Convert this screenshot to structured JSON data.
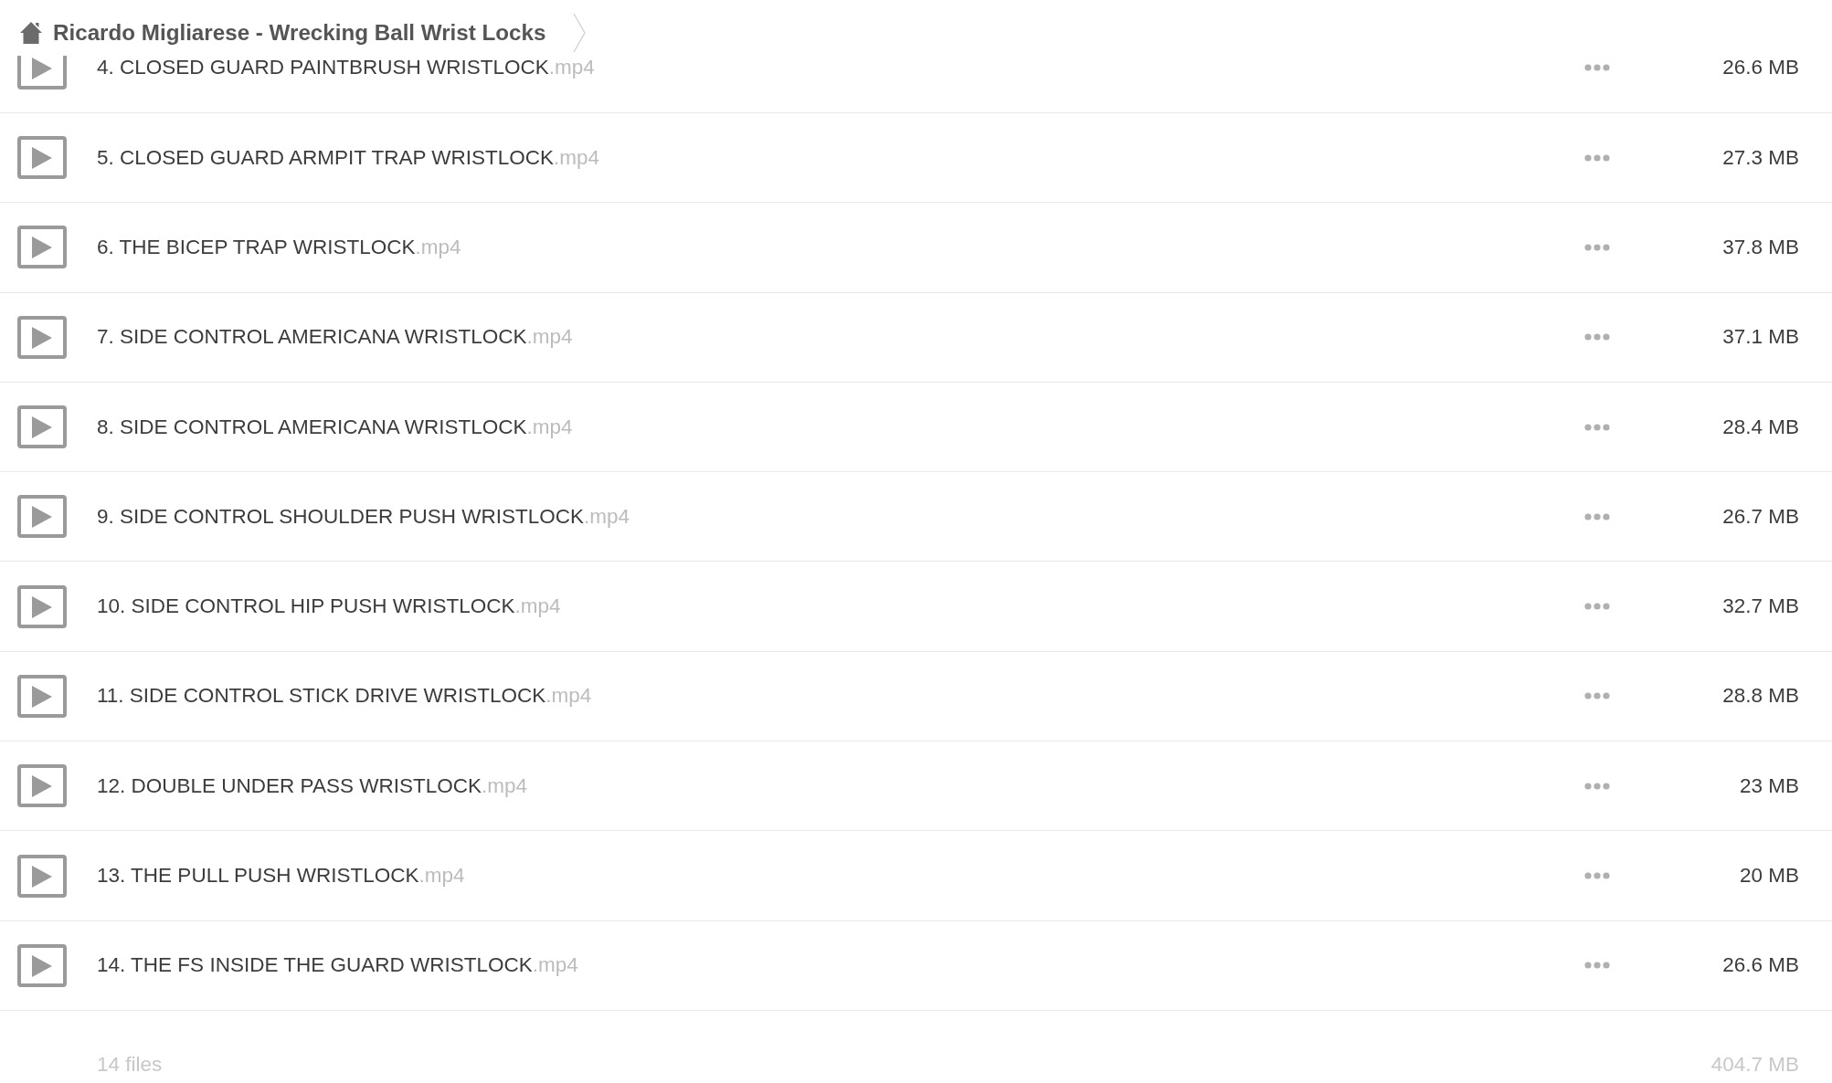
{
  "breadcrumb": {
    "title": "Ricardo Migliarese - Wrecking Ball Wrist Locks"
  },
  "files": [
    {
      "name": "4. CLOSED GUARD PAINTBRUSH WRISTLOCK",
      "extension": ".mp4",
      "size": "26.6 MB"
    },
    {
      "name": "5. CLOSED GUARD ARMPIT TRAP WRISTLOCK",
      "extension": ".mp4",
      "size": "27.3 MB"
    },
    {
      "name": "6. THE BICEP TRAP WRISTLOCK",
      "extension": ".mp4",
      "size": "37.8 MB"
    },
    {
      "name": "7. SIDE CONTROL AMERICANA WRISTLOCK",
      "extension": ".mp4",
      "size": "37.1 MB"
    },
    {
      "name": "8. SIDE CONTROL AMERICANA WRISTLOCK",
      "extension": ".mp4",
      "size": "28.4 MB"
    },
    {
      "name": "9. SIDE CONTROL SHOULDER PUSH WRISTLOCK",
      "extension": ".mp4",
      "size": "26.7 MB"
    },
    {
      "name": "10. SIDE CONTROL HIP PUSH WRISTLOCK",
      "extension": ".mp4",
      "size": "32.7 MB"
    },
    {
      "name": "11. SIDE CONTROL STICK DRIVE WRISTLOCK",
      "extension": ".mp4",
      "size": "28.8 MB"
    },
    {
      "name": "12. DOUBLE UNDER PASS WRISTLOCK",
      "extension": ".mp4",
      "size": "23 MB"
    },
    {
      "name": "13. THE PULL PUSH WRISTLOCK",
      "extension": ".mp4",
      "size": "20 MB"
    },
    {
      "name": "14. THE FS INSIDE THE GUARD WRISTLOCK",
      "extension": ".mp4",
      "size": "26.6 MB"
    }
  ],
  "footer": {
    "file_count": "14 files",
    "total_size": "404.7 MB"
  }
}
